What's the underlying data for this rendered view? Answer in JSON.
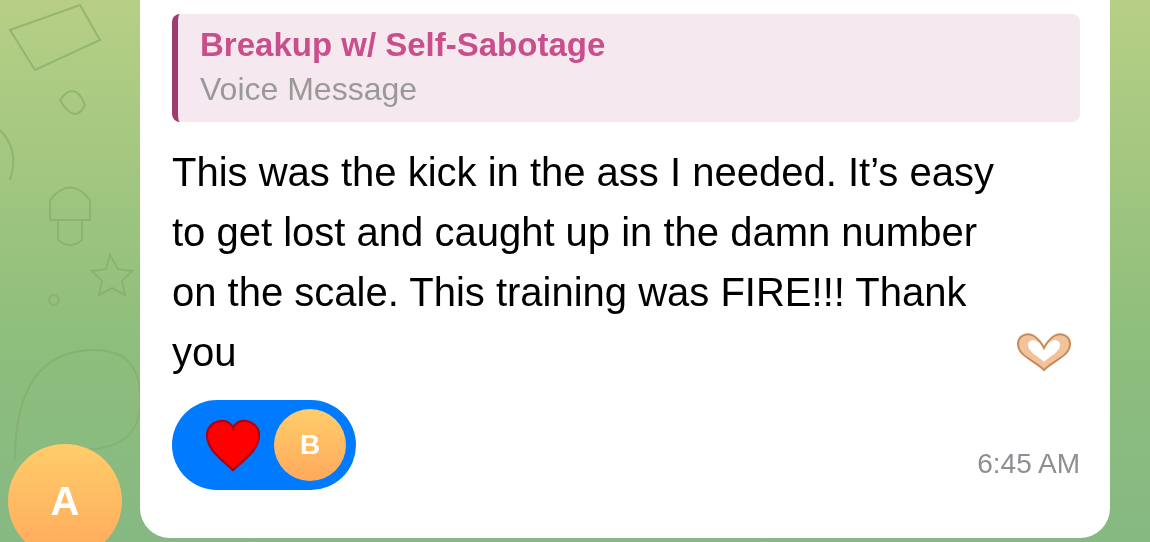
{
  "avatar": {
    "initial": "A"
  },
  "message": {
    "reply": {
      "title": "Breakup w/ Self-Sabotage",
      "subtitle": "Voice Message"
    },
    "text": "This was the kick in the ass I needed. It’s easy to get lost and caught up in the damn number on the scale. This training was FIRE!!! Thank you",
    "reactions": [
      {
        "kind": "heart",
        "selected": true,
        "avatar_initial": "B"
      }
    ],
    "time": "6:45 AM"
  }
}
